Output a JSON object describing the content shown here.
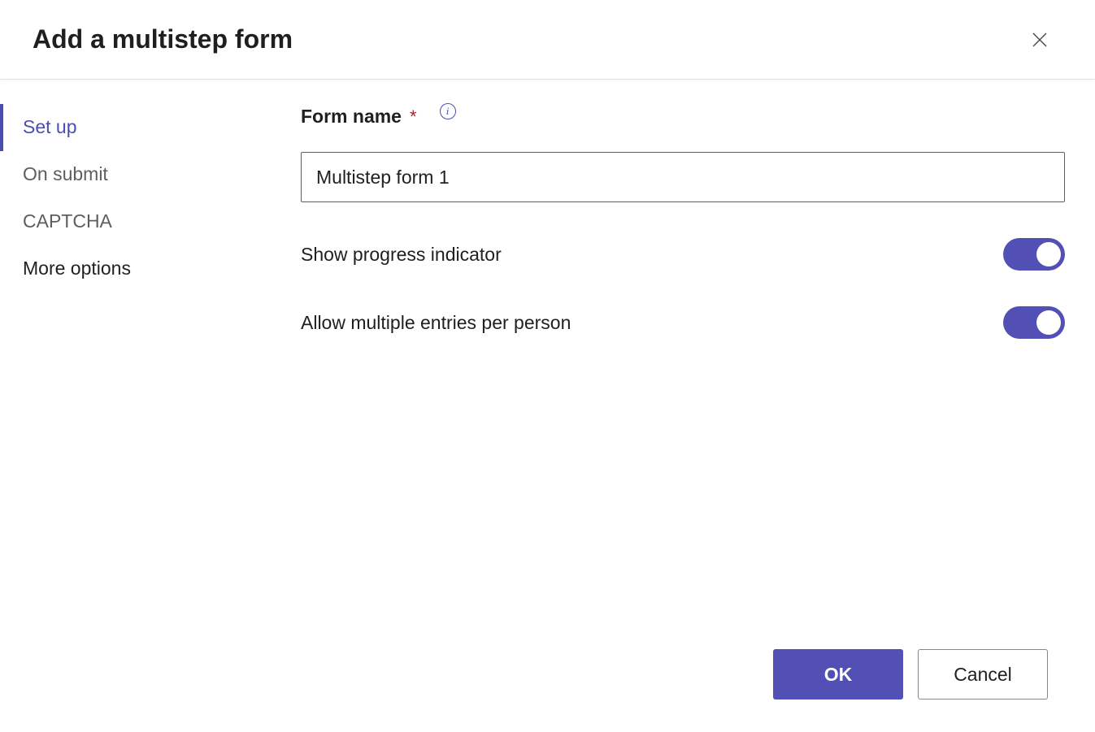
{
  "dialog": {
    "title": "Add a multistep form"
  },
  "sidebar": {
    "items": [
      {
        "label": "Set up",
        "active": true
      },
      {
        "label": "On submit",
        "active": false
      },
      {
        "label": "CAPTCHA",
        "active": false
      },
      {
        "label": "More options",
        "active": false
      }
    ]
  },
  "form": {
    "name_label": "Form name",
    "name_value": "Multistep form 1",
    "show_progress_label": "Show progress indicator",
    "show_progress_value": true,
    "allow_multiple_label": "Allow multiple entries per person",
    "allow_multiple_value": true
  },
  "buttons": {
    "ok": "OK",
    "cancel": "Cancel"
  },
  "icons": {
    "info_glyph": "i"
  }
}
